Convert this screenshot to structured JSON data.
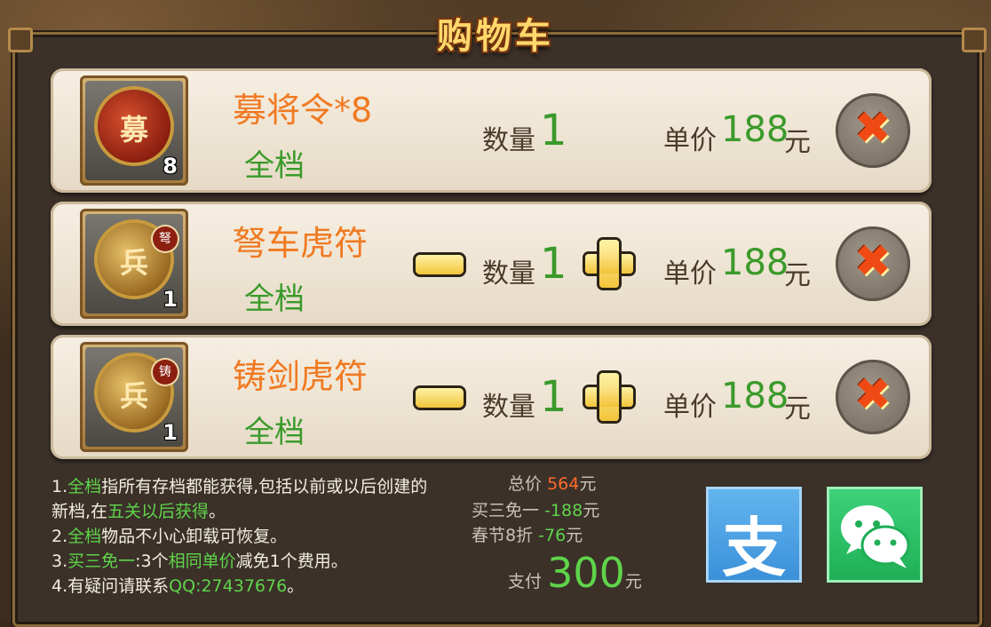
{
  "title": "购物车",
  "items": [
    {
      "name": "募将令*8",
      "scope": "全档",
      "qty_label": "数量",
      "qty": "1",
      "price_label": "单价",
      "price": "188",
      "unit": "元",
      "icon_glyph": "募",
      "icon_count": "8",
      "icon_seal": "",
      "has_stepper": false,
      "icon_name": "recruit-token-icon"
    },
    {
      "name": "弩车虎符",
      "scope": "全档",
      "qty_label": "数量",
      "qty": "1",
      "price_label": "单价",
      "price": "188",
      "unit": "元",
      "icon_glyph": "兵",
      "icon_count": "1",
      "icon_seal": "弩",
      "has_stepper": true,
      "icon_name": "ballista-tiger-tally-icon"
    },
    {
      "name": "铸剑虎符",
      "scope": "全档",
      "qty_label": "数量",
      "qty": "1",
      "price_label": "单价",
      "price": "188",
      "unit": "元",
      "icon_glyph": "兵",
      "icon_count": "1",
      "icon_seal": "铸",
      "has_stepper": true,
      "icon_name": "sword-tiger-tally-icon"
    }
  ],
  "notes": [
    {
      "num": "1.",
      "hl": "全档",
      "text": "指所有存档都能获得,包括以前或以后创建的新档,在",
      "hl2": "五关以后获得",
      "tail": "。"
    },
    {
      "num": "2.",
      "hl": "全档",
      "text": "物品不小心卸载可恢复。",
      "hl2": "",
      "tail": ""
    },
    {
      "num": "3.",
      "hl": "买三免一",
      "text": ":3个",
      "hl2": "相同单价",
      "tail": "减免1个费用。"
    },
    {
      "num": "4.",
      "hl": "",
      "text": "有疑问请联系",
      "hl2": "QQ:27437676",
      "tail": "。"
    }
  ],
  "summary": {
    "total_label": "总价",
    "total_value": "564",
    "total_unit": "元",
    "promo1_label": "买三免一",
    "promo1_value": "-188",
    "promo1_unit": "元",
    "promo2_label": "春节8折",
    "promo2_value": "-76",
    "promo2_unit": "元",
    "pay_label": "支付",
    "pay_value": "300",
    "pay_unit": "元"
  },
  "payment": {
    "alipay_glyph": "支"
  }
}
